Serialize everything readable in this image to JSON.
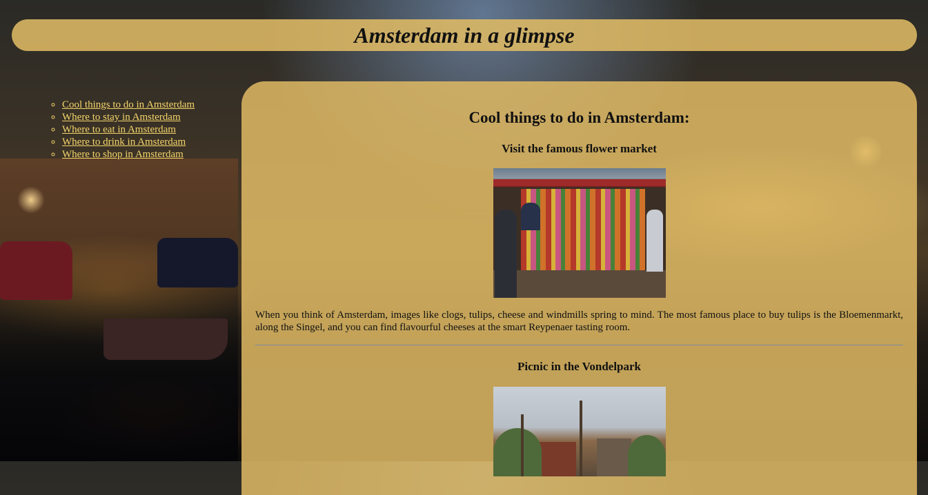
{
  "header": {
    "title": "Amsterdam in a glimpse"
  },
  "nav": {
    "items": [
      {
        "label": "Cool things to do in Amsterdam"
      },
      {
        "label": "Where to stay in Amsterdam"
      },
      {
        "label": "Where to eat in Amsterdam"
      },
      {
        "label": "Where to drink in Amsterdam"
      },
      {
        "label": "Where to shop in Amsterdam"
      }
    ]
  },
  "main": {
    "heading": "Cool things to do in Amsterdam:",
    "sections": [
      {
        "title": "Visit the famous flower market",
        "image_name": "flower-market-photo",
        "text": "When you think of Amsterdam, images like clogs, tulips, cheese and windmills spring to mind. The most famous place to buy tulips is the Bloemenmarkt, along the Singel, and you can find flavourful cheeses at the smart Reypenaer tasting room."
      },
      {
        "title": "Picnic in the Vondelpark",
        "image_name": "vondelpark-photo"
      }
    ]
  },
  "colors": {
    "panel": "#deb964",
    "link": "#f4d56a",
    "divider": "#7a8aa0"
  }
}
